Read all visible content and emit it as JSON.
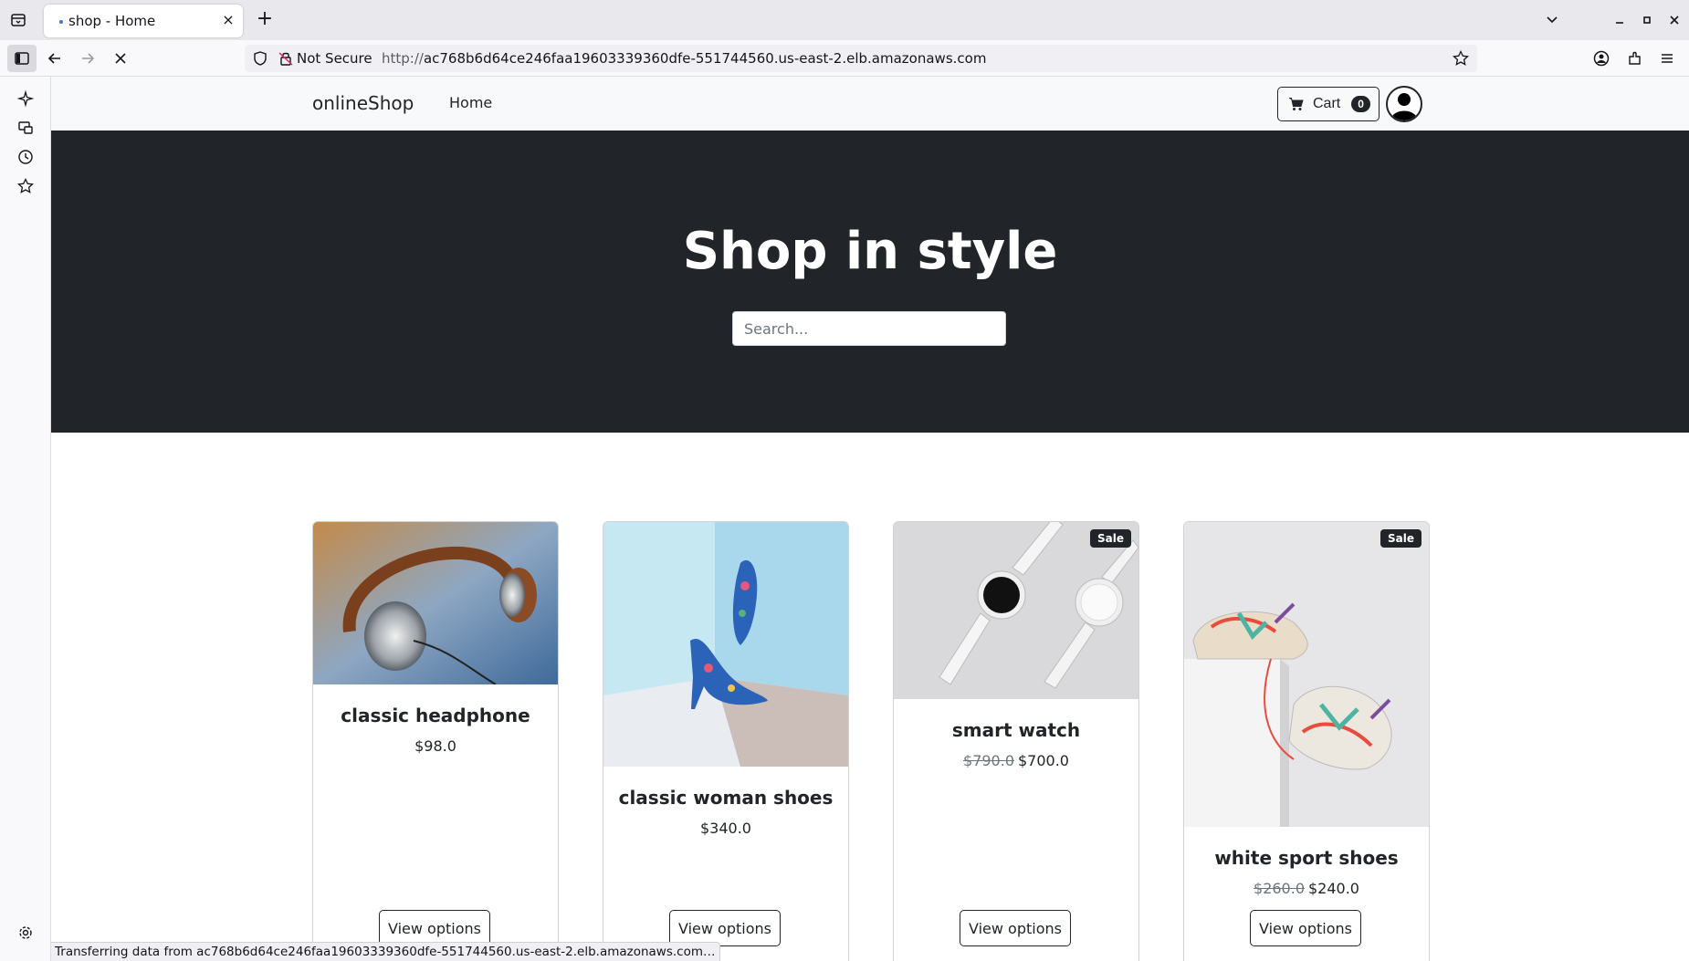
{
  "browser": {
    "tab_title": "shop - Home",
    "not_secure_label": "Not Secure",
    "url_prefix": "http://",
    "url_host": "ac768b6d64ce246faa19603339360dfe-551744560.us-east-2.elb.amazonaws.com",
    "status_text": "Transferring data from ac768b6d64ce246faa19603339360dfe-551744560.us-east-2.elb.amazonaws.com…"
  },
  "site": {
    "brand": "onlineShop",
    "nav_home": "Home",
    "cart_label": "Cart",
    "cart_count": "0"
  },
  "hero": {
    "title": "Shop in style",
    "search_placeholder": "Search..."
  },
  "products": [
    {
      "name": "classic headphone",
      "price": "$98.0",
      "old_price": "",
      "sale": false,
      "button": "View options"
    },
    {
      "name": "classic woman shoes",
      "price": "$340.0",
      "old_price": "",
      "sale": false,
      "button": "View options"
    },
    {
      "name": "smart watch",
      "price": "$700.0",
      "old_price": "$790.0",
      "sale": true,
      "sale_label": "Sale",
      "button": "View options"
    },
    {
      "name": "white sport shoes",
      "price": "$240.0",
      "old_price": "$260.0",
      "sale": true,
      "sale_label": "Sale",
      "button": "View options"
    }
  ],
  "colors": {
    "hero_bg": "#212529",
    "nav_bg": "#f8f9fa"
  }
}
